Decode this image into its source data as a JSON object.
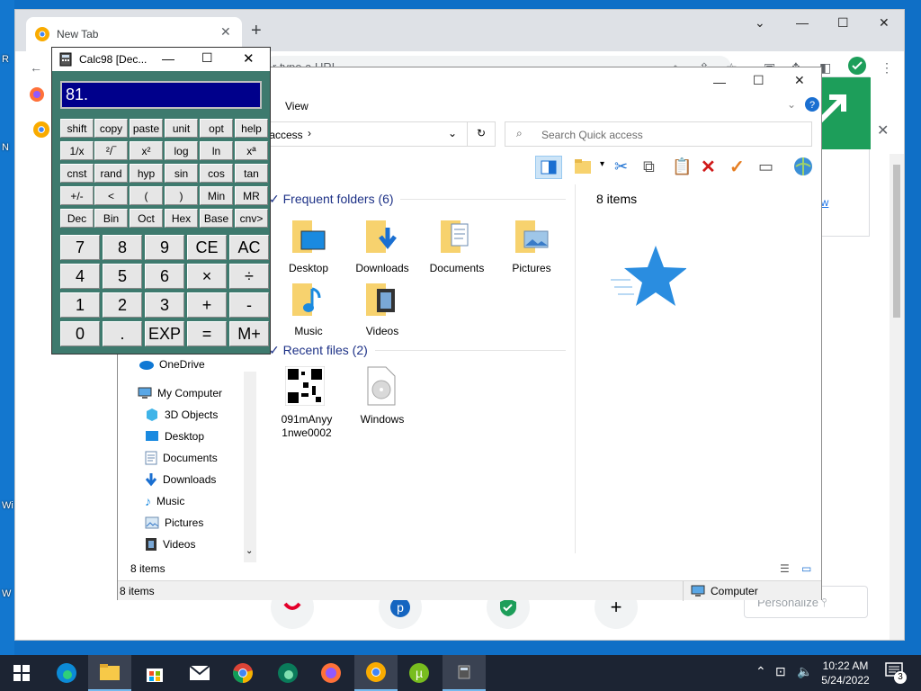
{
  "desktop": {
    "fragments": [
      "R",
      "N",
      "Wi",
      "W"
    ]
  },
  "chrome": {
    "tab_title": "New Tab",
    "omnibox_placeholder": "r type a URL",
    "promo_link": "ow",
    "personalize_label": "Personalize",
    "colors": {
      "promo": "#1d9e5a",
      "tab": "#ffffff",
      "titlebar": "#dee1e6"
    }
  },
  "explorer": {
    "ribbon_tab": "View",
    "address": "k access",
    "search_placeholder": "Search Quick access",
    "frequent_header": "Frequent folders (6)",
    "recent_header": "Recent files (2)",
    "frequent_folders": [
      "Desktop",
      "Downloads",
      "Documents",
      "Pictures",
      "Music",
      "Videos"
    ],
    "recent_files": [
      {
        "name_line1": "091mAnyy",
        "name_line2": "1nwe0002",
        "icon": "qr-code-icon"
      },
      {
        "name_line1": "Windows",
        "name_line2": "",
        "icon": "disc-file-icon"
      }
    ],
    "nav_items": [
      {
        "label": "OneDrive",
        "icon": "onedrive-icon"
      },
      {
        "label": "My Computer",
        "icon": "computer-icon"
      },
      {
        "label": "3D Objects",
        "icon": "cube-icon"
      },
      {
        "label": "Desktop",
        "icon": "desktop-icon"
      },
      {
        "label": "Documents",
        "icon": "documents-icon"
      },
      {
        "label": "Downloads",
        "icon": "download-arrow-icon"
      },
      {
        "label": "Music",
        "icon": "music-note-icon"
      },
      {
        "label": "Pictures",
        "icon": "pictures-icon"
      },
      {
        "label": "Videos",
        "icon": "film-icon"
      }
    ],
    "preview_count": "8 items",
    "items_count": "8 items",
    "status_left": "8 items",
    "status_right": "Computer"
  },
  "calc": {
    "title": "Calc98 [Dec...",
    "display": "81.",
    "func_rows": [
      [
        "shift",
        "copy",
        "paste",
        "unit",
        "opt",
        "help"
      ],
      [
        "1/x",
        "²/‾",
        "x²",
        "log",
        "ln",
        "xª"
      ],
      [
        "cnst",
        "rand",
        "hyp",
        "sin",
        "cos",
        "tan"
      ],
      [
        "+/-",
        "<",
        "(",
        ")",
        "Min",
        "MR"
      ],
      [
        "Dec",
        "Bin",
        "Oct",
        "Hex",
        "Base",
        "cnv>"
      ]
    ],
    "num_rows": [
      [
        "7",
        "8",
        "9",
        "CE",
        "AC"
      ],
      [
        "4",
        "5",
        "6",
        "×",
        "÷"
      ],
      [
        "1",
        "2",
        "3",
        "+",
        "-"
      ],
      [
        "0",
        ".",
        "EXP",
        "=",
        "M+"
      ]
    ],
    "colors": {
      "body": "#3e7a6e",
      "display_bg": "#00008b"
    }
  },
  "taskbar": {
    "time": "10:22 AM",
    "date": "5/24/2022",
    "notification_count": "3",
    "apps": [
      "start-icon",
      "edge-icon",
      "file-explorer-icon",
      "store-icon",
      "mail-icon",
      "chrome-icon",
      "edge-dev-icon",
      "firefox-icon",
      "chrome-canary-icon",
      "utorrent-icon",
      "calculator-icon"
    ]
  }
}
